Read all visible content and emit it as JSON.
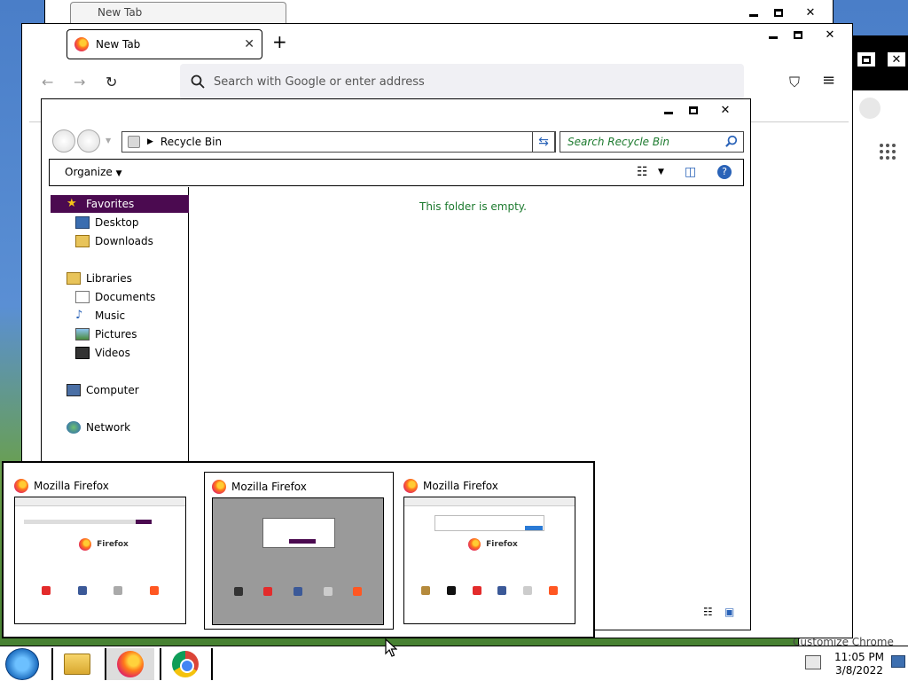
{
  "background_windows": {
    "top_tab_title": "New Tab"
  },
  "firefox": {
    "tab_label": "New Tab",
    "new_tab_symbol": "+",
    "tab_close_symbol": "✕",
    "url_placeholder": "Search with Google or enter address"
  },
  "chrome": {
    "customize_label": "Customize Chrome"
  },
  "explorer": {
    "address_segment": "Recycle Bin",
    "search_placeholder": "Search Recycle Bin",
    "organize_label": "Organize",
    "empty_message": "This folder is empty.",
    "nav": {
      "favorites": "Favorites",
      "desktop": "Desktop",
      "downloads": "Downloads",
      "libraries": "Libraries",
      "documents": "Documents",
      "music": "Music",
      "pictures": "Pictures",
      "videos": "Videos",
      "computer": "Computer",
      "network": "Network"
    }
  },
  "preview": {
    "thumbnails": [
      {
        "title": "Mozilla Firefox",
        "inner_brand": "Firefox"
      },
      {
        "title": "Mozilla Firefox",
        "inner_brand": ""
      },
      {
        "title": "Mozilla Firefox",
        "inner_brand": "Firefox"
      }
    ]
  },
  "taskbar": {
    "time": "11:05 PM",
    "date": "3/8/2022"
  },
  "colors": {
    "selection": "#4b0a50",
    "green_text": "#1c7a2e",
    "link_blue": "#2a63b8"
  }
}
